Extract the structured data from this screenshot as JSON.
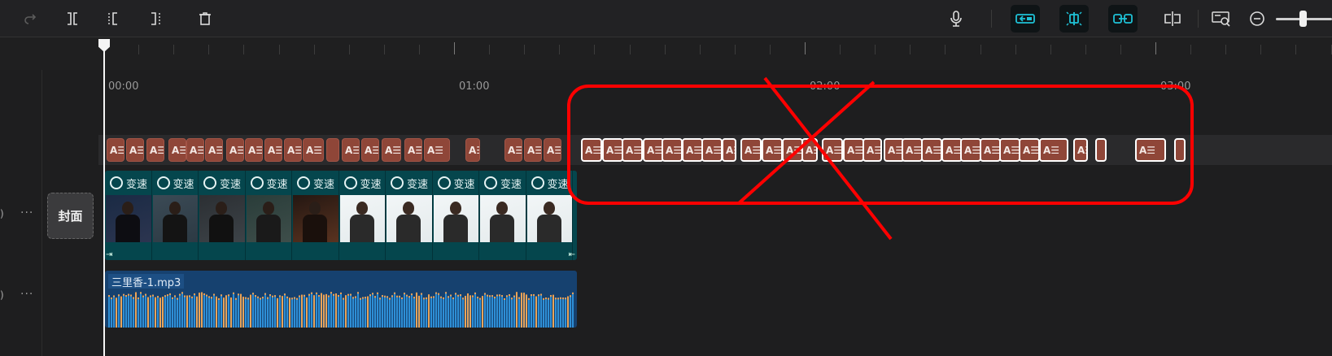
{
  "toolbar": {
    "tools": [
      "redo-icon",
      "split-icon",
      "trim-left-icon",
      "trim-right-icon",
      "delete-icon"
    ],
    "right_tools": [
      "microphone-icon",
      "snap-main-track-icon",
      "snap-preview-axis-icon",
      "snap-link-icon",
      "split-preview-icon",
      "zoom-fit-icon",
      "zoom-out-icon"
    ]
  },
  "ruler": {
    "labels": [
      "00:00",
      "01:00",
      "02:00",
      "03:00"
    ]
  },
  "cover": {
    "label": "封面"
  },
  "video": {
    "effect_label": "变速"
  },
  "audio": {
    "filename": "三里香-1.mp3"
  },
  "text_clip_label": "A☰",
  "colors": {
    "text_clip": "#8f4638",
    "video_track": "#05464d",
    "audio_track": "#16416f",
    "accent": "#1fc1d6",
    "annotation": "#ff0000"
  },
  "side": {
    "dots": "···"
  }
}
